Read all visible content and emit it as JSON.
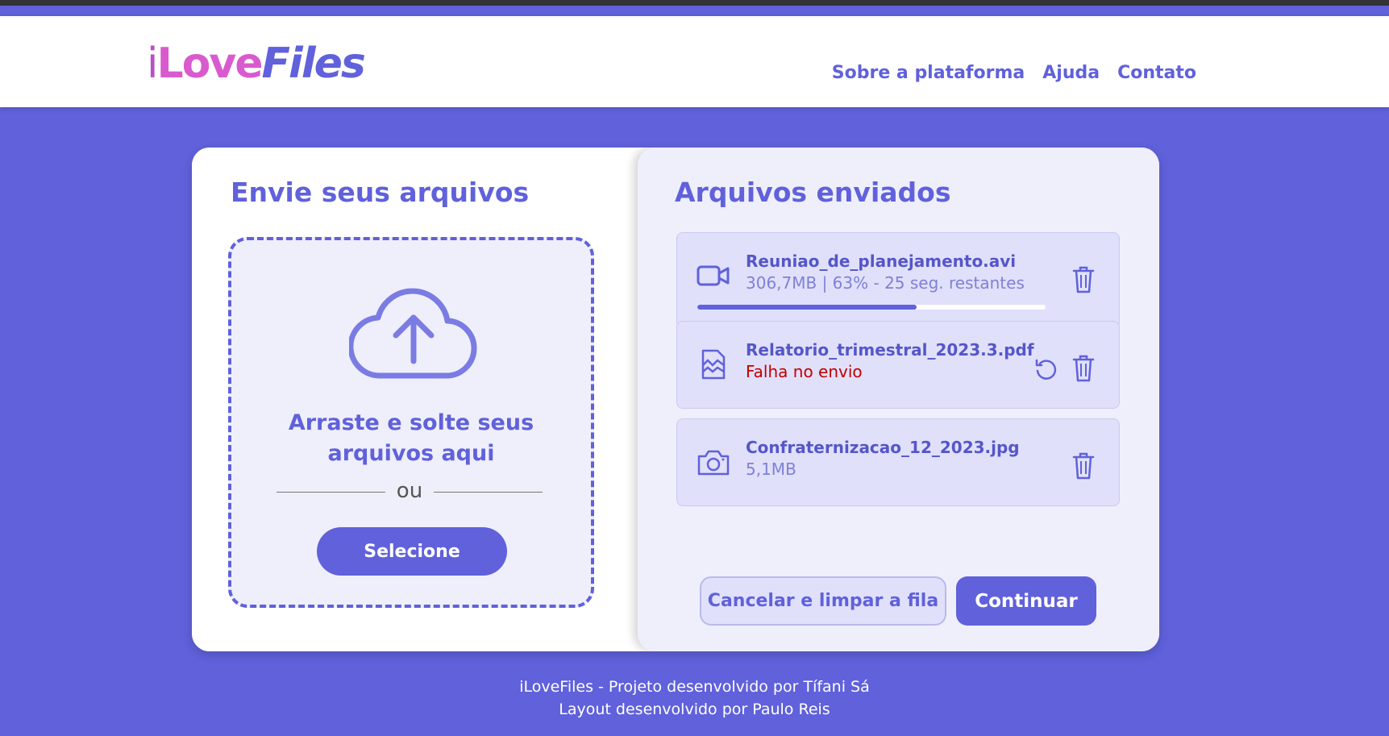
{
  "header": {
    "logo": {
      "part1": "i",
      "part2": "Love",
      "part3": "Files"
    },
    "nav": [
      {
        "label": "Sobre a plataforma"
      },
      {
        "label": "Ajuda"
      },
      {
        "label": "Contato"
      }
    ]
  },
  "upload": {
    "title": "Envie seus arquivos",
    "drop_text_line1": "Arraste e solte seus",
    "drop_text_line2": "arquivos aqui",
    "or_text": "ou",
    "select_label": "Selecione"
  },
  "sent": {
    "title": "Arquivos enviados",
    "files": [
      {
        "name": "Reuniao_de_planejamento.avi",
        "meta": "306,7MB | 63% - 25 seg. restantes",
        "icon": "video-camera-icon",
        "progress_percent": 63
      },
      {
        "name": "Relatorio_trimestral_2023.3.pdf",
        "meta": "Falha no envio",
        "icon": "broken-document-icon",
        "status": "error"
      },
      {
        "name": "Confraternizacao_12_2023.jpg",
        "meta": "5,1MB",
        "icon": "photo-camera-icon"
      }
    ],
    "cancel_label": "Cancelar e limpar a fila",
    "continue_label": "Continuar"
  },
  "footer": {
    "line1": "iLoveFiles - Projeto desenvolvido por Tífani Sá",
    "line2": "Layout desenvolvido por Paulo Reis"
  },
  "colors": {
    "brand": "#6061DB",
    "logo_pink": "#D95ACF",
    "panel_bg": "#EFEFFC",
    "item_bg": "#E0E0FA",
    "error": "#C00000"
  }
}
